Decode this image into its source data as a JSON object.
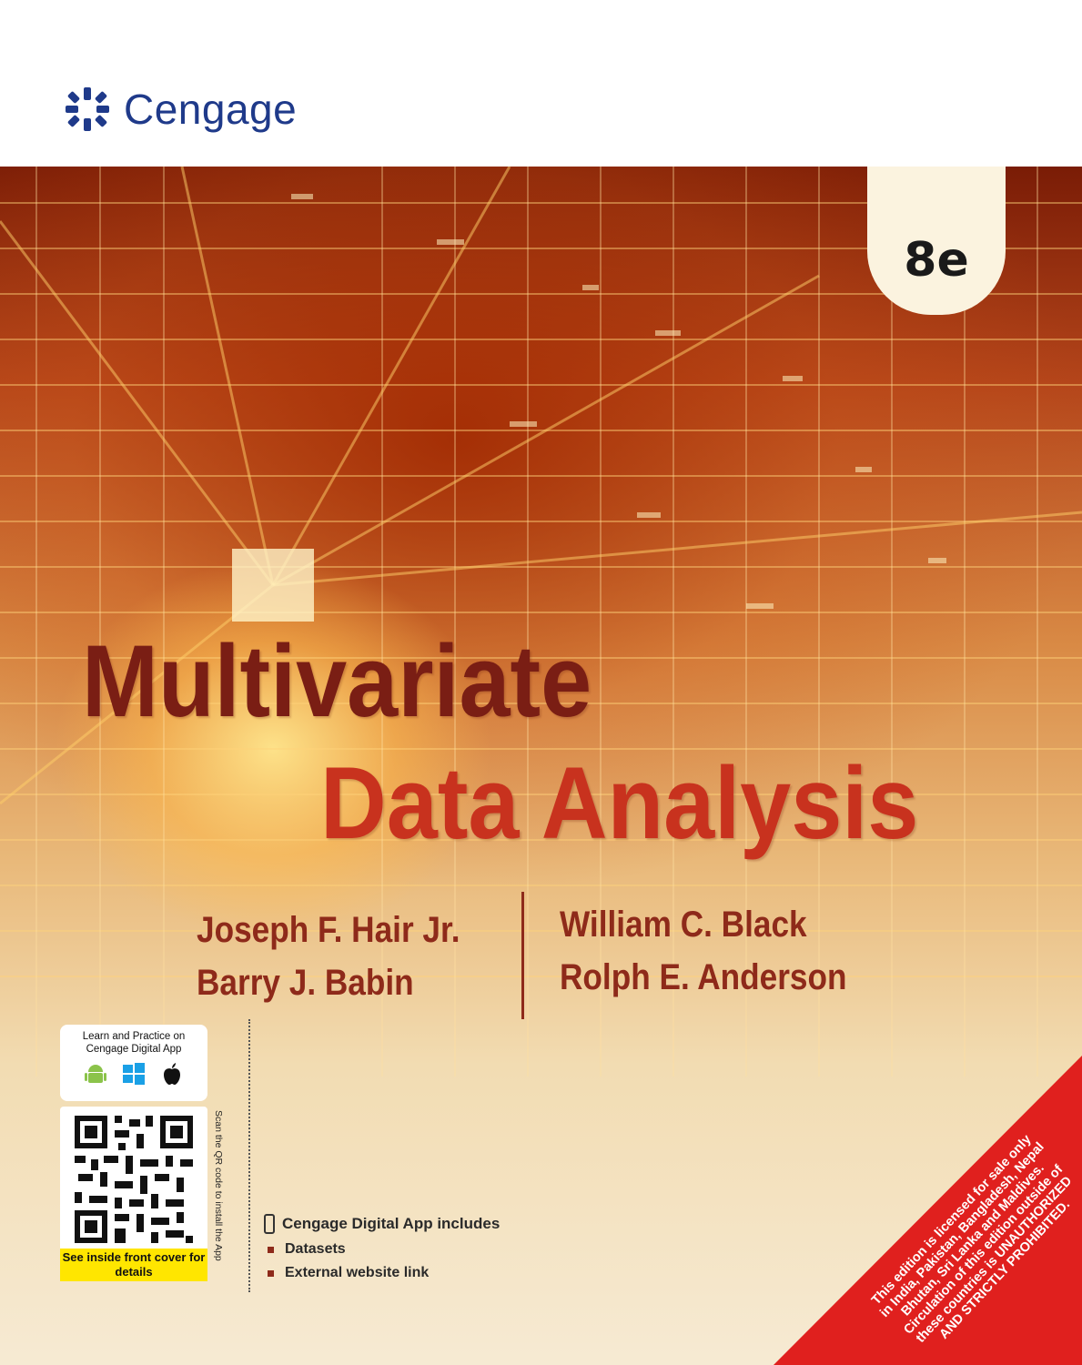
{
  "publisher": {
    "name": "Cengage"
  },
  "edition": "8e",
  "title": {
    "line1": "Multivariate",
    "line2": "Data Analysis"
  },
  "authors": {
    "left": [
      "Joseph F. Hair Jr.",
      "Barry J. Babin"
    ],
    "right": [
      "William C. Black",
      "Rolph E. Anderson"
    ]
  },
  "app_box": {
    "text": "Learn and Practice on Cengage Digital App",
    "platforms": [
      "android-icon",
      "windows-icon",
      "apple-icon"
    ]
  },
  "qr": {
    "note": "See inside front cover for details",
    "side_text": "Scan the QR code to install the App"
  },
  "includes": {
    "heading": "Cengage Digital App includes",
    "items": [
      "Datasets",
      "External website link"
    ]
  },
  "license_notice": "This edition is licensed for sale only in India, Pakistan, Bangladesh, Nepal Bhutan, Sri Lanka and Maldives. Circulation of this edition outside of these countries is UNAUTHORIZED AND STRICTLY PROHIBITED.",
  "colors": {
    "brand_blue": "#1f3a8a",
    "title_dark": "#7a1e14",
    "title_red": "#c8321e",
    "author": "#8e2a1a",
    "license_red": "#e0201e"
  }
}
